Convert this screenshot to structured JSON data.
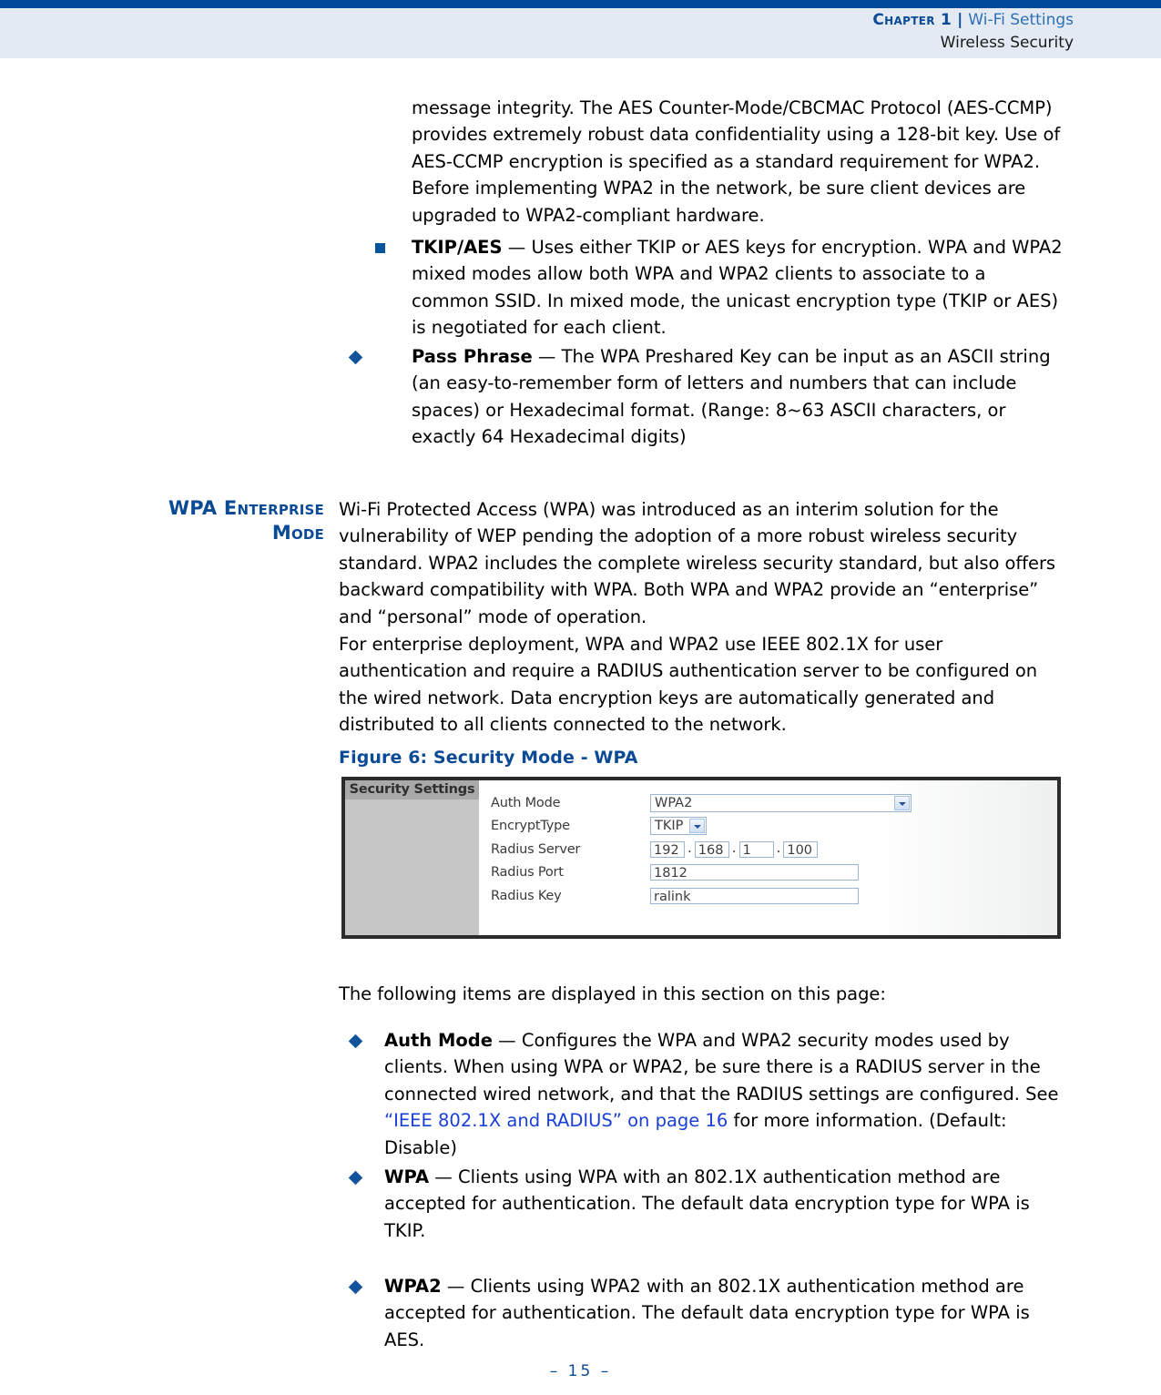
{
  "header": {
    "chapter": "Chapter 1",
    "separator": "|",
    "doc_title": "Wi-Fi Settings",
    "section": "Wireless Security"
  },
  "content": {
    "continued_paragraph": "message integrity. The AES Counter-Mode/CBCMAC Protocol (AES-CCMP) provides extremely robust data confidentiality using a 128-bit key. Use of AES-CCMP encryption is specified as a standard requirement for WPA2. Before implementing WPA2 in the network, be sure client devices are upgraded to WPA2-compliant hardware.",
    "tkip_aes_term": "TKIP/AES",
    "tkip_aes_dash": " — ",
    "tkip_aes_body": "Uses either TKIP or AES keys for encryption. WPA and WPA2 mixed modes allow both WPA and WPA2 clients to associate to a common SSID. In mixed mode, the unicast encryption type (TKIP or AES) is negotiated for each client.",
    "pass_phrase_term": "Pass Phrase",
    "pass_phrase_dash": " — ",
    "pass_phrase_body": "The WPA Preshared Key can be input as an ASCII string (an easy-to-remember form of letters and numbers that can include spaces) or Hexadecimal format. (Range: 8~63 ASCII characters, or exactly 64 Hexadecimal digits)",
    "sidehead_line1": "WPA Enterprise",
    "sidehead_line2": "Mode",
    "wpa_intro": "Wi-Fi Protected Access (WPA) was introduced as an interim solution for the vulnerability of WEP pending the adoption of a more robust wireless security standard. WPA2 includes the complete wireless security standard, but also offers backward compatibility with WPA. Both WPA and WPA2 provide an “enter­prise” and “personal” mode of operation.",
    "enterprise_para": "For enterprise deployment, WPA and WPA2 use IEEE 802.1X for user authentication and require a RADIUS authentication server to be configured on the wired network. Data encryption keys are automatically generated and distributed to all clients connected to the network.",
    "figure_caption": "Figure 6:  Security Mode - WPA",
    "following_items_intro": "The following items are displayed in this section on this page:",
    "auth_mode_term": "Auth Mode",
    "auth_mode_dash": " — ",
    "auth_mode_body_part1": "Configures the WPA and WPA2 security modes used by clients. When using WPA or WPA2, be sure there is a RADIUS server in the connected wired network, and that the RADIUS settings are configured. See ",
    "auth_mode_link": "“IEEE 802.1X and RADIUS” on page 16",
    "auth_mode_body_part2": " for more information. (Default: Disable)",
    "wpa_term": "WPA",
    "wpa_dash": " — ",
    "wpa_body": "Clients using WPA with an 802.1X authentication method are accepted for authentication. The default data encryption type for WPA is TKIP.",
    "wpa2_term": "WPA2",
    "wpa2_dash": " — ",
    "wpa2_body": "Clients using WPA2 with an 802.1X authentication method are accepted for authentication. The default data encryption type for WPA is AES."
  },
  "figure": {
    "sidebar_title": "Security Settings",
    "fields": [
      {
        "label": "Auth Mode",
        "value": "WPA2",
        "type": "select"
      },
      {
        "label": "EncryptType",
        "value": "TKIP",
        "type": "select"
      },
      {
        "label": "Radius Server",
        "value": "",
        "type": "ip"
      },
      {
        "label": "Radius Port",
        "value": "1812",
        "type": "text"
      },
      {
        "label": "Radius Key",
        "value": "ralink",
        "type": "text"
      }
    ],
    "ip_octets": [
      "192",
      "168",
      "1",
      "100"
    ],
    "ip_separator": "."
  },
  "footer": {
    "page_number": "–  15  –"
  },
  "colors": {
    "accent_blue": "#0b4a95",
    "rule_blue": "#004a99",
    "header_band": "#e3eaf3",
    "link_blue": "#1a3fd6",
    "bullet_blue": "#12549c",
    "figure_border": "#2b2b2b",
    "figure_sidebar": "#c6c6c6",
    "figure_sidebar_header": "#a9a9a9"
  }
}
